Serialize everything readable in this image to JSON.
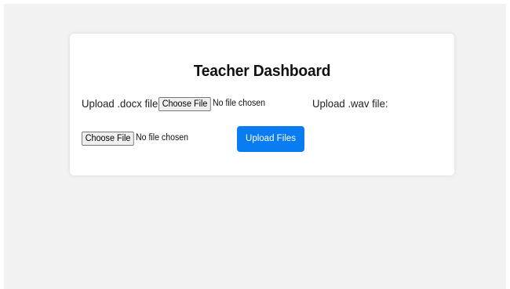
{
  "dashboard": {
    "title": "Teacher Dashboard"
  },
  "upload_docx": {
    "label": "Upload .docx file:",
    "button_label": "Choose File",
    "status_text": "No file chosen"
  },
  "upload_wav": {
    "label": "Upload .wav file:",
    "button_label": "Choose File",
    "status_text": "No file chosen"
  },
  "submit": {
    "label": "Upload Files"
  },
  "colors": {
    "page_background": "#f2f2f2",
    "card_background": "#ffffff",
    "primary_button": "#0a7cf2"
  }
}
